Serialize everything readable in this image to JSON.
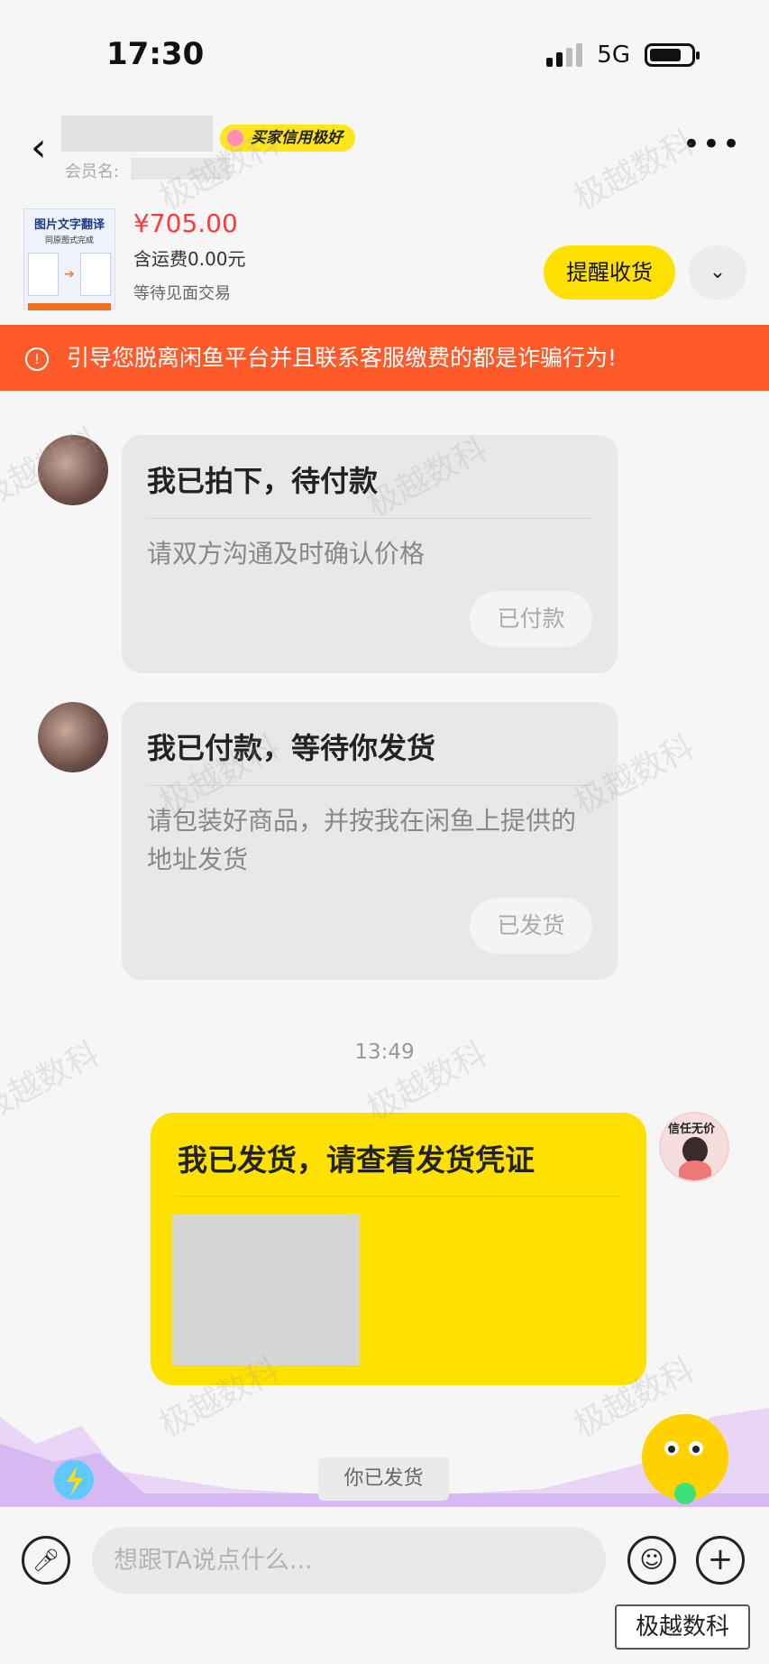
{
  "status_bar": {
    "time": "17:30",
    "network": "5G"
  },
  "header": {
    "back_icon": "chevron-left-icon",
    "credit_badge": "买家信用极好",
    "member_label": "会员名:",
    "more_icon": "more-dots-icon"
  },
  "product": {
    "thumb_title": "图片文字翻译",
    "thumb_subtitle": "同原图式完成",
    "price": "¥705.00",
    "shipping": "含运费0.00元",
    "status": "等待见面交易",
    "remind_label": "提醒收货",
    "expand_icon": "chevron-down-icon"
  },
  "warning": {
    "icon": "alert-circle-icon",
    "text": "引导您脱离闲鱼平台并且联系客服缴费的都是诈骗行为!"
  },
  "messages": [
    {
      "title": "我已拍下，待付款",
      "text": "请双方沟通及时确认价格",
      "button": "已付款"
    },
    {
      "title": "我已付款，等待你发货",
      "text": "请包装好商品，并按我在闲鱼上提供的地址发货",
      "button": "已发货"
    }
  ],
  "timestamp": "13:49",
  "sent_message": {
    "title": "我已发货，请查看发货凭证",
    "avatar_text": "信任无价"
  },
  "system_notice": "你已发货",
  "input": {
    "placeholder": "想跟TA说点什么...",
    "mic_icon": "microphone-icon",
    "emoji_icon": "emoji-icon",
    "plus_icon": "plus-icon"
  },
  "watermark": "极越数科",
  "corner_badge": "极越数科"
}
